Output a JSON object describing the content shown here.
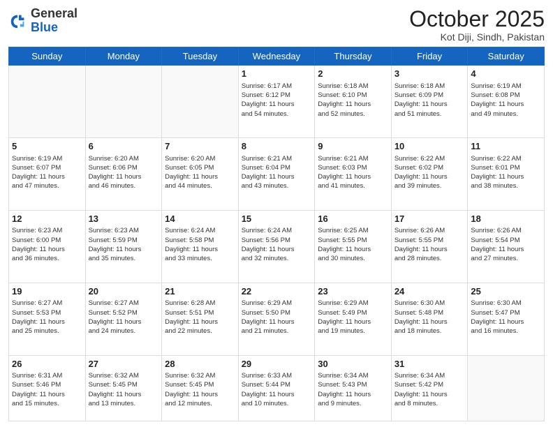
{
  "header": {
    "logo_general": "General",
    "logo_blue": "Blue",
    "month_title": "October 2025",
    "location": "Kot Diji, Sindh, Pakistan"
  },
  "days_of_week": [
    "Sunday",
    "Monday",
    "Tuesday",
    "Wednesday",
    "Thursday",
    "Friday",
    "Saturday"
  ],
  "weeks": [
    [
      {
        "day": "",
        "info": ""
      },
      {
        "day": "",
        "info": ""
      },
      {
        "day": "",
        "info": ""
      },
      {
        "day": "1",
        "info": "Sunrise: 6:17 AM\nSunset: 6:12 PM\nDaylight: 11 hours\nand 54 minutes."
      },
      {
        "day": "2",
        "info": "Sunrise: 6:18 AM\nSunset: 6:10 PM\nDaylight: 11 hours\nand 52 minutes."
      },
      {
        "day": "3",
        "info": "Sunrise: 6:18 AM\nSunset: 6:09 PM\nDaylight: 11 hours\nand 51 minutes."
      },
      {
        "day": "4",
        "info": "Sunrise: 6:19 AM\nSunset: 6:08 PM\nDaylight: 11 hours\nand 49 minutes."
      }
    ],
    [
      {
        "day": "5",
        "info": "Sunrise: 6:19 AM\nSunset: 6:07 PM\nDaylight: 11 hours\nand 47 minutes."
      },
      {
        "day": "6",
        "info": "Sunrise: 6:20 AM\nSunset: 6:06 PM\nDaylight: 11 hours\nand 46 minutes."
      },
      {
        "day": "7",
        "info": "Sunrise: 6:20 AM\nSunset: 6:05 PM\nDaylight: 11 hours\nand 44 minutes."
      },
      {
        "day": "8",
        "info": "Sunrise: 6:21 AM\nSunset: 6:04 PM\nDaylight: 11 hours\nand 43 minutes."
      },
      {
        "day": "9",
        "info": "Sunrise: 6:21 AM\nSunset: 6:03 PM\nDaylight: 11 hours\nand 41 minutes."
      },
      {
        "day": "10",
        "info": "Sunrise: 6:22 AM\nSunset: 6:02 PM\nDaylight: 11 hours\nand 39 minutes."
      },
      {
        "day": "11",
        "info": "Sunrise: 6:22 AM\nSunset: 6:01 PM\nDaylight: 11 hours\nand 38 minutes."
      }
    ],
    [
      {
        "day": "12",
        "info": "Sunrise: 6:23 AM\nSunset: 6:00 PM\nDaylight: 11 hours\nand 36 minutes."
      },
      {
        "day": "13",
        "info": "Sunrise: 6:23 AM\nSunset: 5:59 PM\nDaylight: 11 hours\nand 35 minutes."
      },
      {
        "day": "14",
        "info": "Sunrise: 6:24 AM\nSunset: 5:58 PM\nDaylight: 11 hours\nand 33 minutes."
      },
      {
        "day": "15",
        "info": "Sunrise: 6:24 AM\nSunset: 5:56 PM\nDaylight: 11 hours\nand 32 minutes."
      },
      {
        "day": "16",
        "info": "Sunrise: 6:25 AM\nSunset: 5:55 PM\nDaylight: 11 hours\nand 30 minutes."
      },
      {
        "day": "17",
        "info": "Sunrise: 6:26 AM\nSunset: 5:55 PM\nDaylight: 11 hours\nand 28 minutes."
      },
      {
        "day": "18",
        "info": "Sunrise: 6:26 AM\nSunset: 5:54 PM\nDaylight: 11 hours\nand 27 minutes."
      }
    ],
    [
      {
        "day": "19",
        "info": "Sunrise: 6:27 AM\nSunset: 5:53 PM\nDaylight: 11 hours\nand 25 minutes."
      },
      {
        "day": "20",
        "info": "Sunrise: 6:27 AM\nSunset: 5:52 PM\nDaylight: 11 hours\nand 24 minutes."
      },
      {
        "day": "21",
        "info": "Sunrise: 6:28 AM\nSunset: 5:51 PM\nDaylight: 11 hours\nand 22 minutes."
      },
      {
        "day": "22",
        "info": "Sunrise: 6:29 AM\nSunset: 5:50 PM\nDaylight: 11 hours\nand 21 minutes."
      },
      {
        "day": "23",
        "info": "Sunrise: 6:29 AM\nSunset: 5:49 PM\nDaylight: 11 hours\nand 19 minutes."
      },
      {
        "day": "24",
        "info": "Sunrise: 6:30 AM\nSunset: 5:48 PM\nDaylight: 11 hours\nand 18 minutes."
      },
      {
        "day": "25",
        "info": "Sunrise: 6:30 AM\nSunset: 5:47 PM\nDaylight: 11 hours\nand 16 minutes."
      }
    ],
    [
      {
        "day": "26",
        "info": "Sunrise: 6:31 AM\nSunset: 5:46 PM\nDaylight: 11 hours\nand 15 minutes."
      },
      {
        "day": "27",
        "info": "Sunrise: 6:32 AM\nSunset: 5:45 PM\nDaylight: 11 hours\nand 13 minutes."
      },
      {
        "day": "28",
        "info": "Sunrise: 6:32 AM\nSunset: 5:45 PM\nDaylight: 11 hours\nand 12 minutes."
      },
      {
        "day": "29",
        "info": "Sunrise: 6:33 AM\nSunset: 5:44 PM\nDaylight: 11 hours\nand 10 minutes."
      },
      {
        "day": "30",
        "info": "Sunrise: 6:34 AM\nSunset: 5:43 PM\nDaylight: 11 hours\nand 9 minutes."
      },
      {
        "day": "31",
        "info": "Sunrise: 6:34 AM\nSunset: 5:42 PM\nDaylight: 11 hours\nand 8 minutes."
      },
      {
        "day": "",
        "info": ""
      }
    ]
  ]
}
